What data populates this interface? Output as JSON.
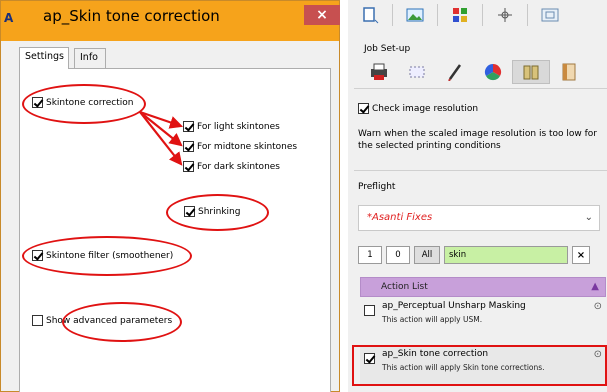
{
  "dialog": {
    "title": "ap_Skin tone correction",
    "app_icon_text": "A",
    "close_label": "×",
    "tabs": [
      {
        "label": "Settings"
      },
      {
        "label": "Info"
      }
    ],
    "options": {
      "skintone_correction": {
        "label": "Skintone correction",
        "checked": true
      },
      "light": {
        "label": "For light skintones",
        "checked": true
      },
      "midtone": {
        "label": "For midtone skintones",
        "checked": true
      },
      "dark": {
        "label": "For dark skintones",
        "checked": true
      },
      "shrinking": {
        "label": "Shrinking",
        "checked": true
      },
      "filter": {
        "label": "Skintone filter (smoothener)",
        "checked": true
      },
      "advanced": {
        "label": "Show advanced parameters",
        "checked": false
      }
    }
  },
  "panel": {
    "job_setup_label": "Job Set-up",
    "check_resolution": {
      "label": "Check image resolution",
      "checked": true
    },
    "warn_text": "Warn when the scaled image resolution is too low for the selected printing conditions",
    "preflight_label": "Preflight",
    "preflight_value": "*Asanti Fixes",
    "filter_buttons": {
      "one": "1",
      "zero": "0",
      "all": "All"
    },
    "search_value": "skin",
    "clear_label": "×",
    "action_list_label": "Action List",
    "actions": [
      {
        "title": "ap_Perceptual Unsharp Masking",
        "description": "This action will apply USM.",
        "checked": false
      },
      {
        "title": "ap_Skin tone correction",
        "description": "This action will apply Skin tone corrections.",
        "checked": true
      }
    ]
  },
  "colors": {
    "titlebar": "#f6a31b",
    "annotation": "#e01212",
    "search_bg": "#c8f0a4",
    "action_header": "#c8a0da"
  }
}
